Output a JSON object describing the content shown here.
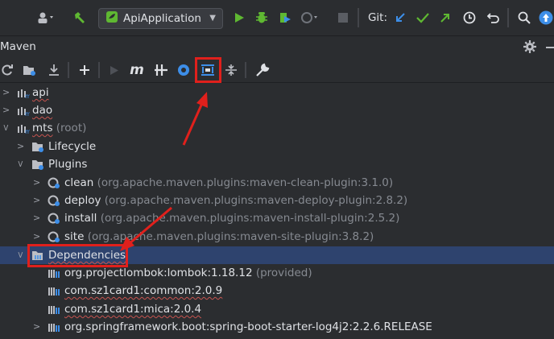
{
  "toolbar": {
    "run_config": "ApiApplication",
    "vcs_label": "Git:",
    "colors": {
      "green": "#5fb832",
      "blue": "#3d8ee8",
      "red": "#e0201c"
    }
  },
  "maven": {
    "title": "Maven",
    "tool_icons": [
      "refresh-icon",
      "generate-sources-icon",
      "download-icon",
      "plus-icon",
      "run-icon",
      "execute-goal-icon",
      "toggle-offline-icon",
      "skip-tests-icon",
      "show-dependencies-icon",
      "collapse-all-icon",
      "settings-wrench-icon"
    ]
  },
  "tree": {
    "api": "api",
    "dao": "dao",
    "mts": "mts",
    "mts_suffix": "(root)",
    "lifecycle": "Lifecycle",
    "plugins": "Plugins",
    "plugin_items": [
      {
        "name": "clean",
        "detail": "(org.apache.maven.plugins:maven-clean-plugin:3.1.0)"
      },
      {
        "name": "deploy",
        "detail": "(org.apache.maven.plugins:maven-deploy-plugin:2.8.2)"
      },
      {
        "name": "install",
        "detail": "(org.apache.maven.plugins:maven-install-plugin:2.5.2)"
      },
      {
        "name": "site",
        "detail": "(org.apache.maven.plugins:maven-site-plugin:3.8.2)"
      }
    ],
    "dependencies": "Dependencies",
    "dep_items": [
      {
        "name": "org.projectlombok:lombok:1.18.12",
        "detail": "(provided)"
      },
      {
        "name": "com.sz1card1:common:2.0.9",
        "detail": ""
      },
      {
        "name": "com.sz1card1:mica:2.0.4",
        "detail": ""
      },
      {
        "name": "org.springframework.boot:spring-boot-starter-log4j2:2.2.6.RELEASE",
        "detail": ""
      }
    ]
  }
}
